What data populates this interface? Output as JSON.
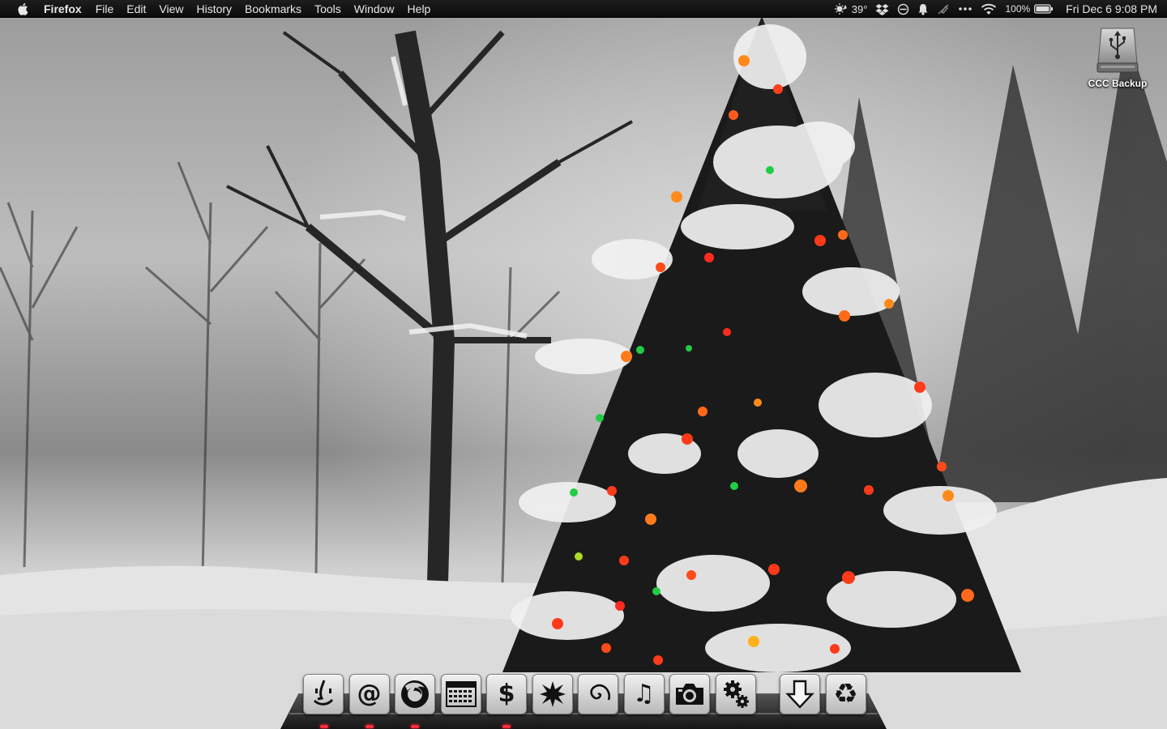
{
  "menubar": {
    "app_name": "Firefox",
    "menus": [
      "File",
      "Edit",
      "View",
      "History",
      "Bookmarks",
      "Tools",
      "Window",
      "Help"
    ],
    "status": {
      "weather": "39°",
      "battery": "100%",
      "datetime": "Fri Dec 6  9:08 PM"
    }
  },
  "desktop": {
    "drive_label": "CCC Backup"
  },
  "dock": {
    "items": [
      {
        "name": "finder",
        "icon": "finder-face-icon",
        "glyph": ""
      },
      {
        "name": "mail",
        "icon": "at-sign-icon",
        "glyph": "@"
      },
      {
        "name": "firefox",
        "icon": "firefox-icon",
        "glyph": ""
      },
      {
        "name": "calendar",
        "icon": "calendar-grid-icon",
        "glyph": ""
      },
      {
        "name": "finance",
        "icon": "dollar-sign-icon",
        "glyph": "$"
      },
      {
        "name": "burst",
        "icon": "starburst-icon",
        "glyph": ""
      },
      {
        "name": "spiral",
        "icon": "spiral-icon",
        "glyph": ""
      },
      {
        "name": "music",
        "icon": "music-note-icon",
        "glyph": "♫"
      },
      {
        "name": "camera",
        "icon": "camera-icon",
        "glyph": ""
      },
      {
        "name": "system-preferences",
        "icon": "gears-icon",
        "glyph": ""
      },
      {
        "name": "downloads",
        "icon": "download-arrow-icon",
        "glyph": ""
      },
      {
        "name": "trash",
        "icon": "recycle-icon",
        "glyph": "♻"
      }
    ]
  },
  "colors": {
    "menubar_bg": "#111111",
    "running_indicator": "#ff2a3a"
  }
}
